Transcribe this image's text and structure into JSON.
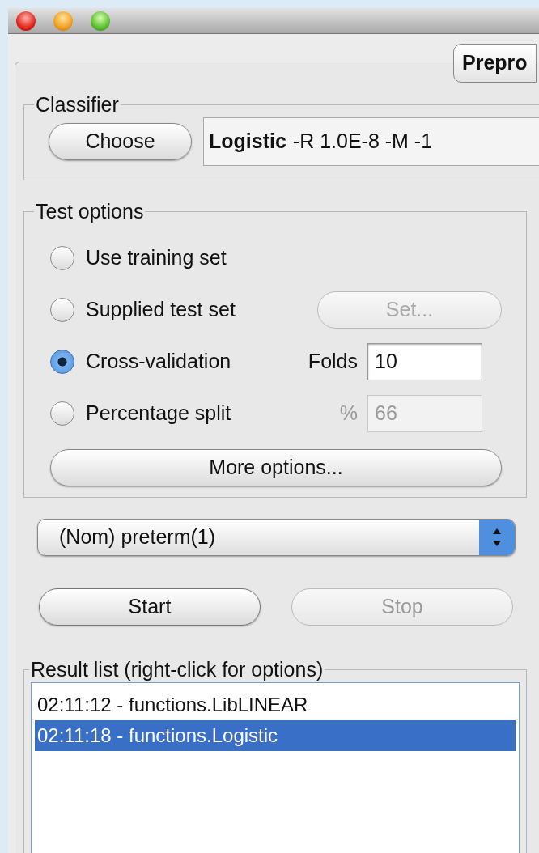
{
  "tabs": [
    {
      "label": "Prepro",
      "selected": false
    }
  ],
  "classifier": {
    "title": "Classifier",
    "button": "Choose",
    "name": "Logistic",
    "options": "-R 1.0E-8 -M -1"
  },
  "test_options": {
    "title": "Test options",
    "options": [
      {
        "label": "Use training set",
        "selected": false
      },
      {
        "label": "Supplied test set",
        "selected": false
      },
      {
        "label": "Cross-validation",
        "selected": true
      },
      {
        "label": "Percentage split",
        "selected": false
      }
    ],
    "set_button": {
      "label": "Set...",
      "disabled": true
    },
    "folds": {
      "label": "Folds",
      "value": "10",
      "disabled": false
    },
    "percentage": {
      "label": "%",
      "value": "66",
      "disabled": true
    },
    "more_options": "More options..."
  },
  "class_attribute": "(Nom) preterm(1)",
  "buttons": [
    {
      "label": "Start",
      "disabled": false
    },
    {
      "label": "Stop",
      "disabled": true
    }
  ],
  "result_list": {
    "title": "Result list (right-click for options)",
    "items": [
      {
        "label": "02:11:12 - functions.LibLINEAR",
        "selected": false
      },
      {
        "label": "02:11:18 - functions.Logistic",
        "selected": true
      }
    ]
  }
}
